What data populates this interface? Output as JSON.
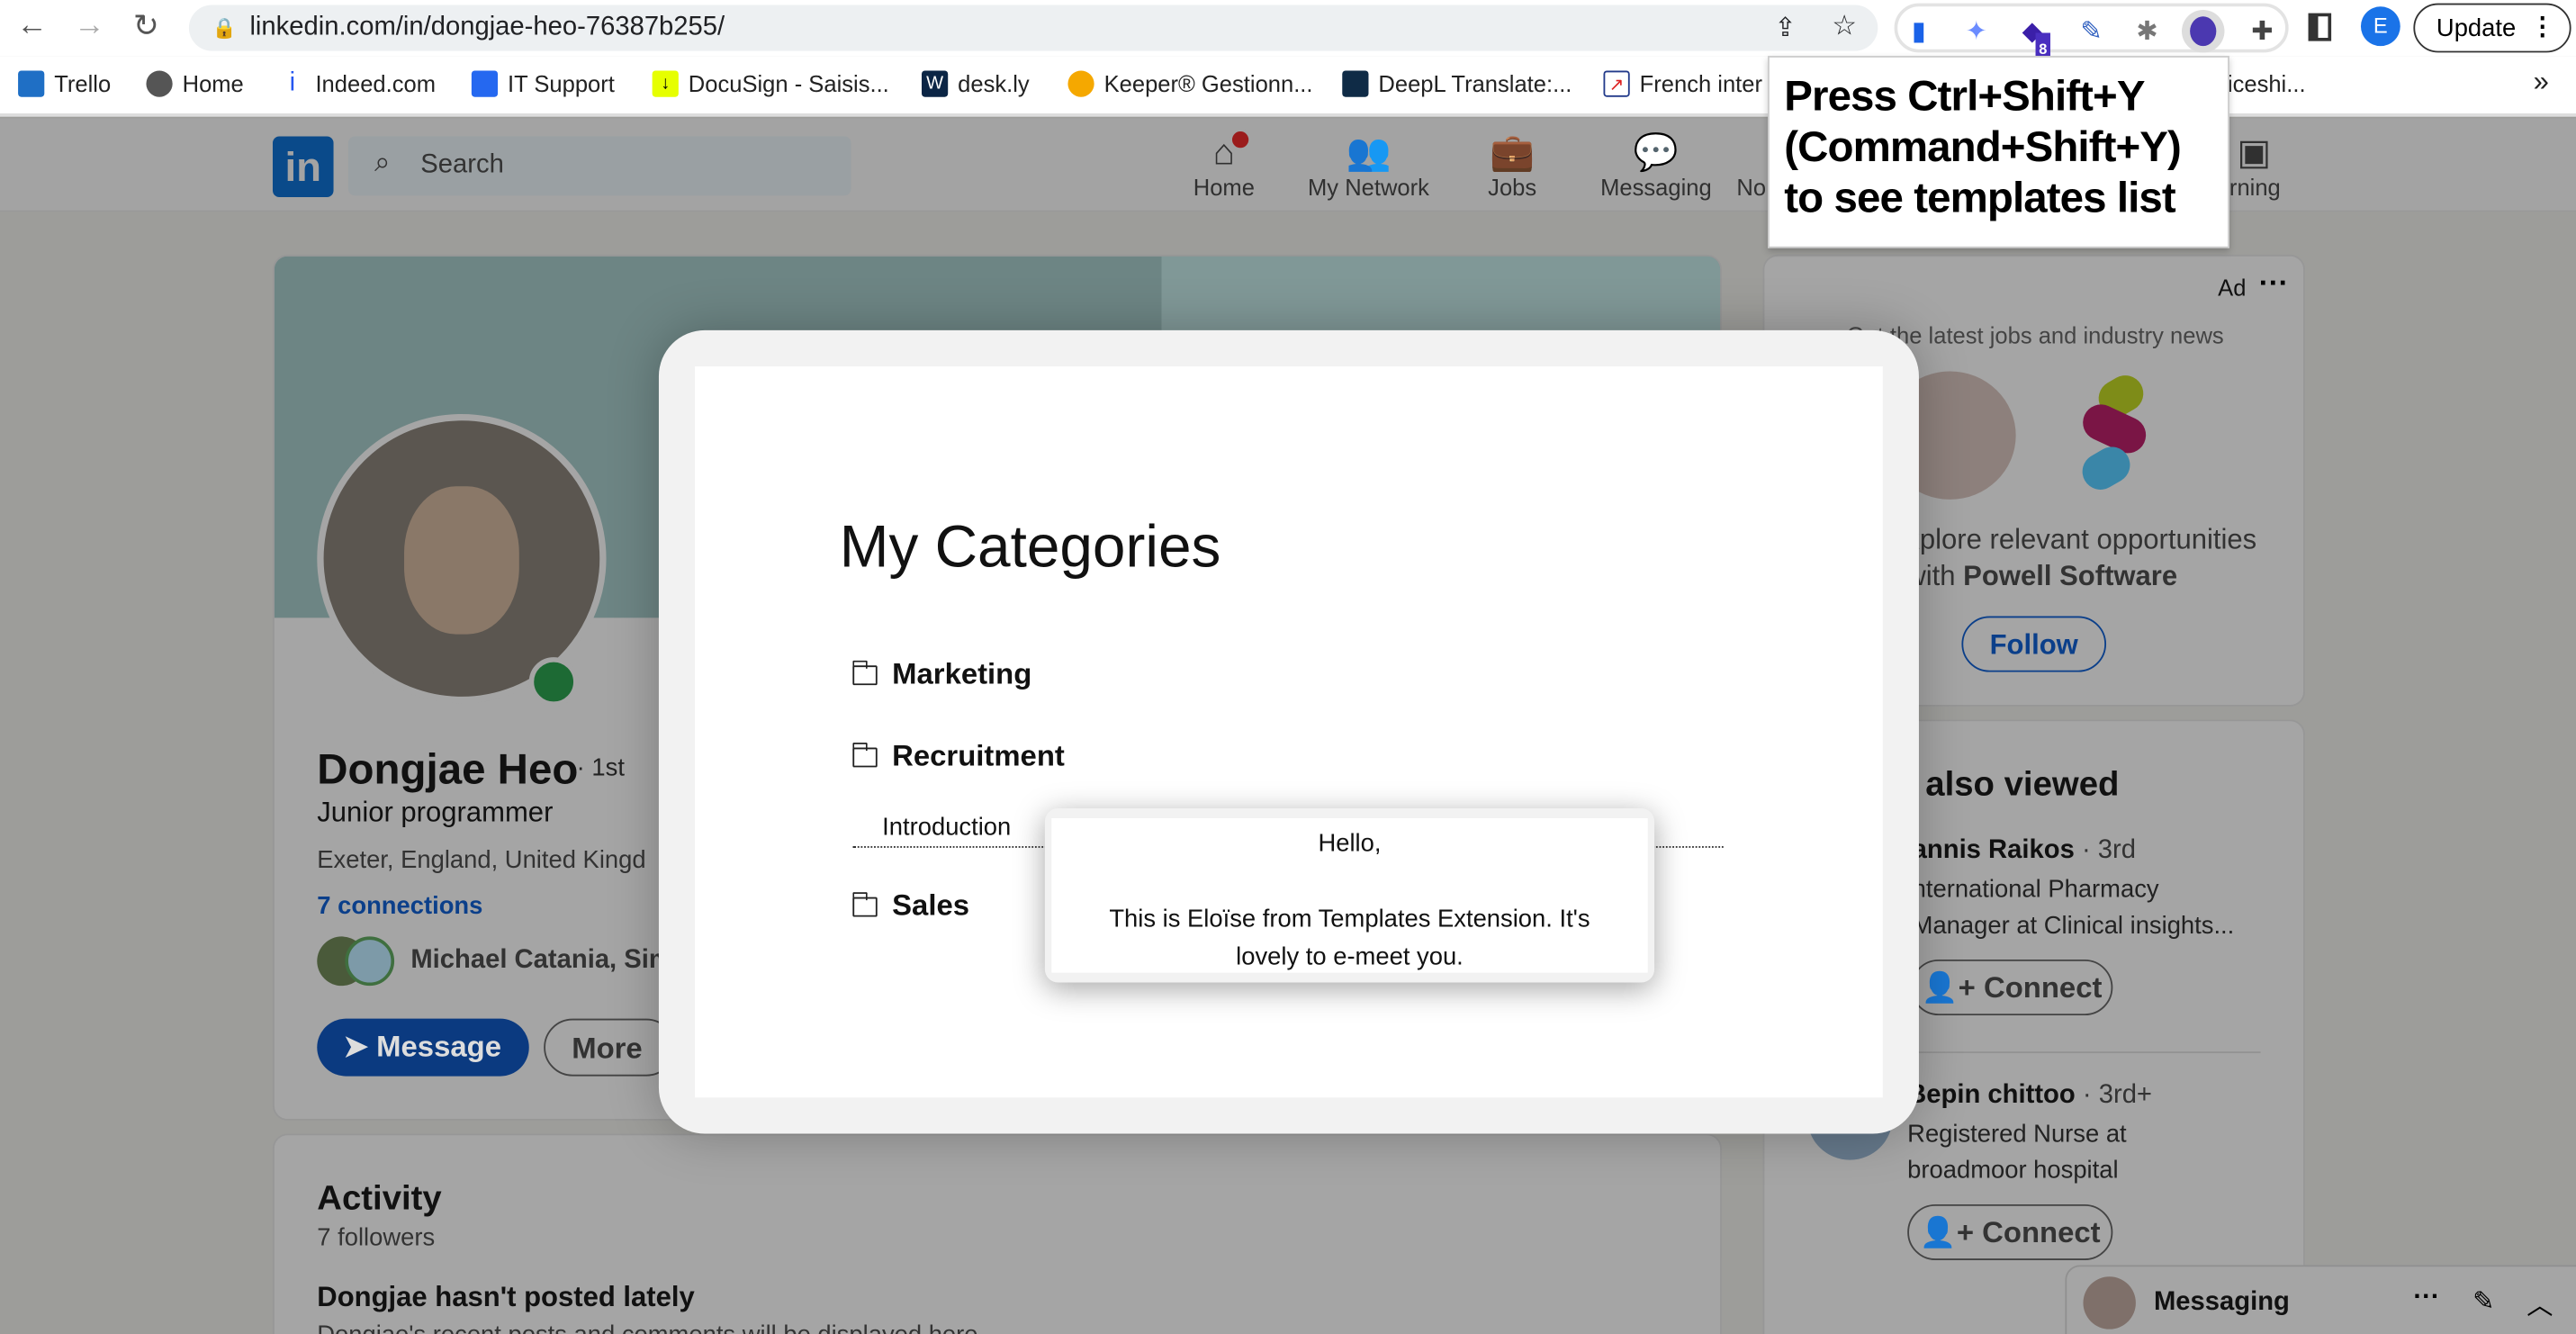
{
  "browser": {
    "url": "linkedin.com/in/dongjae-heo-76387b255/",
    "update_label": "Update",
    "profile_initial": "E",
    "ext_badge": "8",
    "bookmarks": [
      "Trello",
      "Home",
      "Indeed.com",
      "IT Support",
      "DocuSign - Saisis...",
      "desk.ly",
      "Keeper® Gestionn...",
      "DeepL Translate:...",
      "French inter",
      "ticeshi..."
    ],
    "more": "»"
  },
  "ext_tooltip": {
    "line1": "Press Ctrl+Shift+Y",
    "line2": "(Command+Shift+Y)",
    "line3": "to see templates list"
  },
  "linkedin": {
    "logo": "in",
    "search_placeholder": "Search",
    "nav": [
      {
        "label": "Home",
        "icon": "home-icon"
      },
      {
        "label": "My Network",
        "icon": "network-icon"
      },
      {
        "label": "Jobs",
        "icon": "briefcase-icon"
      },
      {
        "label": "Messaging",
        "icon": "chat-icon"
      },
      {
        "label": "No",
        "icon": "bell-icon"
      },
      {
        "label": "rning",
        "icon": "learning-icon"
      }
    ],
    "profile": {
      "name": "Dongjae Heo",
      "degree": "· 1st",
      "headline": "Junior programmer",
      "location": "Exeter, England, United Kingd",
      "connections": "7 connections",
      "mutual": "Michael Catania, Sim",
      "message_label": "Message",
      "more_label": "More"
    },
    "activity": {
      "title": "Activity",
      "followers": "7 followers",
      "empty": "Dongjae hasn't posted lately",
      "empty_sub": "Dongjae's recent posts and comments will be displayed here"
    },
    "ad": {
      "label": "Ad",
      "tagline": "Get the latest jobs and industry news",
      "text1": "xplore relevant opportunities",
      "text2_prefix": "with ",
      "text2_company": "Powell Software",
      "follow_label": "Follow"
    },
    "also_viewed": {
      "title": "also viewed",
      "people": [
        {
          "name": "annis Raikos",
          "degree": "· 3rd",
          "line1": "nternational Pharmacy",
          "line2": "Manager at Clinical insights...",
          "connect": "Connect"
        },
        {
          "name": "Bepin chittoo",
          "degree": "· 3rd+",
          "line1": "Registered Nurse at",
          "line2": "broadmoor hospital",
          "connect": "Connect"
        }
      ]
    },
    "messaging": {
      "label": "Messaging"
    }
  },
  "modal": {
    "title": "My Categories",
    "categories": [
      "Marketing",
      "Recruitment",
      "Sales"
    ],
    "template": "Introduction",
    "preview": {
      "line1": "Hello,",
      "line2": "This is Eloïse from Templates Extension. It's",
      "line3": "lovely to e-meet you."
    }
  },
  "colors": {
    "linkedin_blue": "#0a66c2",
    "modal_bg": "#f2f2f2"
  }
}
